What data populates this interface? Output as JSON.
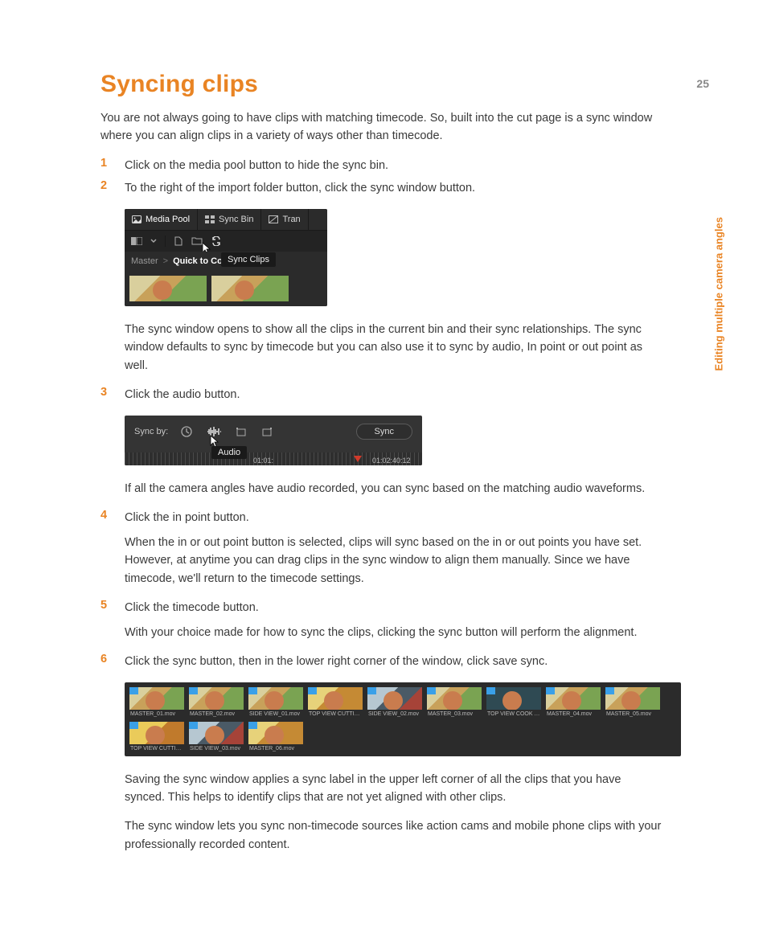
{
  "page_number": "25",
  "side_label": "Editing multiple camera angles",
  "title": "Syncing clips",
  "intro": "You are not always going to have clips with matching timecode. So, built into the cut page is a sync window where you can align clips in a variety of ways other than timecode.",
  "steps": {
    "s1": {
      "num": "1",
      "text": "Click on the media pool button to hide the sync bin."
    },
    "s2": {
      "num": "2",
      "text": "To the right of the import folder button, click the sync window button."
    },
    "after2": "The sync window opens to show all the clips in the current bin and their sync relationships. The sync window defaults to sync by timecode but you can also use it to sync by audio, In point or out point as well.",
    "s3": {
      "num": "3",
      "text": "Click the audio button."
    },
    "after3": "If all the camera angles have audio recorded, you can sync based on the matching audio waveforms.",
    "s4": {
      "num": "4",
      "text": "Click the in point button.",
      "body": "When the in or out point button is selected, clips will sync based on the in or out points you have set. However, at anytime you can drag clips in the sync window to align them manually. Since we have timecode, we'll return to the timecode settings."
    },
    "s5": {
      "num": "5",
      "text": "Click the timecode button.",
      "body": "With your choice made for how to sync the clips, clicking the sync button will perform the alignment."
    },
    "s6": {
      "num": "6",
      "text": "Click the sync button, then in the lower right corner of the window, click save sync."
    }
  },
  "closing1": "Saving the sync window applies a sync label in the upper left corner of all the clips that you have synced. This helps to identify clips that are not yet aligned with other clips.",
  "closing2": "The sync window lets you sync non-timecode sources like action cams and mobile phone clips with your professionally recorded content.",
  "fig1": {
    "tabs": {
      "media_pool": "Media Pool",
      "sync_bin": "Sync Bin",
      "tran": "Tran"
    },
    "tooltip": "Sync Clips",
    "breadcrumb": {
      "master": "Master",
      "sep": ">",
      "current": "Quick to Cook"
    }
  },
  "fig2": {
    "label": "Sync by:",
    "tooltip": "Audio",
    "sync_button": "Sync",
    "tc_left": "01:01:",
    "tc_right": "01:02:40:12"
  },
  "fig3": {
    "clips": [
      "MASTER_01.mov",
      "MASTER_02.mov",
      "SIDE VIEW_01.mov",
      "TOP VIEW CUTTIN...",
      "SIDE VIEW_02.mov",
      "MASTER_03.mov",
      "TOP VIEW COOK T...",
      "MASTER_04.mov",
      "MASTER_05.mov",
      "TOP VIEW CUTTIN...",
      "SIDE VIEW_03.mov",
      "MASTER_06.mov"
    ]
  }
}
